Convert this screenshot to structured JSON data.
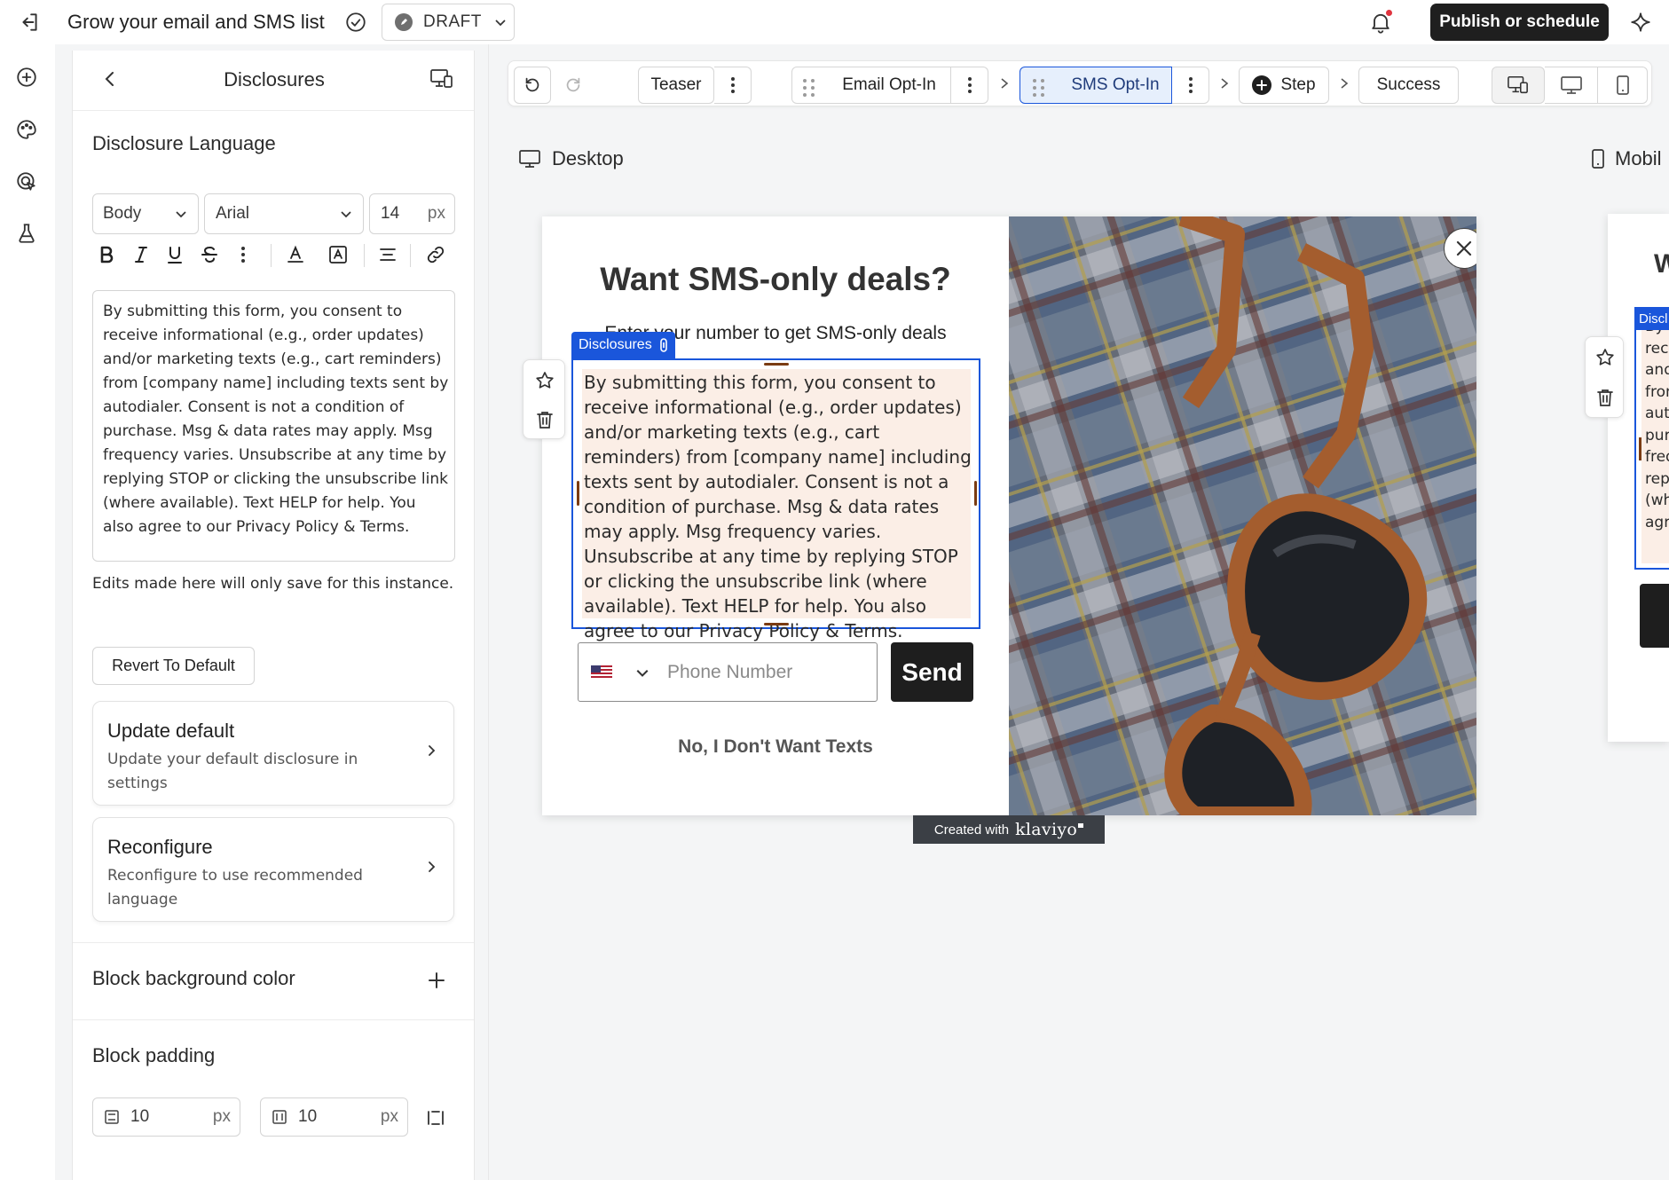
{
  "header": {
    "title": "Grow your email and SMS list",
    "status": "DRAFT",
    "publish_label": "Publish or schedule"
  },
  "panel": {
    "title": "Disclosures",
    "section_title": "Disclosure Language",
    "text_style": "Body",
    "font": "Arial",
    "font_size": "14",
    "font_unit": "px",
    "disclosure_text": "By submitting this form, you consent to receive informational (e.g., order updates) and/or marketing texts (e.g., cart reminders) from [company name] including texts sent by autodialer. Consent is not a condition of purchase. Msg & data rates may apply. Msg frequency varies. Unsubscribe at any time by replying STOP or clicking the unsubscribe link (where available). Text HELP for help. You also agree to our Privacy Policy & Terms.",
    "edit_note": "Edits made here will only save for this instance.",
    "revert_label": "Revert To Default",
    "update_default": {
      "title": "Update default",
      "desc": "Update your default disclosure in settings"
    },
    "reconfigure": {
      "title": "Reconfigure",
      "desc": "Reconfigure to use recommended language"
    },
    "bg_color_label": "Block background color",
    "padding_label": "Block padding",
    "padding_vertical": "10",
    "padding_horizontal": "10",
    "padding_unit": "px"
  },
  "toolbar": {
    "steps": [
      "Teaser",
      "Email Opt-In",
      "SMS Opt-In",
      "Step",
      "Success"
    ],
    "active_step": "SMS Opt-In"
  },
  "canvas": {
    "desktop_label": "Desktop",
    "mobile_label": "Mobil",
    "popup": {
      "heading": "Want SMS-only deals?",
      "subheading": "Enter your number to get SMS-only deals",
      "block_tag": "Disclosures",
      "phone_placeholder": "Phone Number",
      "send_label": "Send",
      "decline_label": "No, I Don't Want Texts",
      "created_with": "Created with",
      "brand": "klaviyo"
    },
    "mobile_preview": {
      "heading_fragment": "W",
      "block_tag": "Discl",
      "text_fragments": [
        "By s",
        "rece",
        "and",
        "fron",
        "auto",
        "pur",
        "freq",
        "rep",
        "(wh",
        "agr"
      ]
    }
  },
  "colors": {
    "accent_blue": "#1a56db",
    "publish_bg": "#1f1f1f",
    "active_step_bg": "#e6effc",
    "disclosure_bg": "#fbeee6",
    "handle_brown": "#7a3b12"
  }
}
